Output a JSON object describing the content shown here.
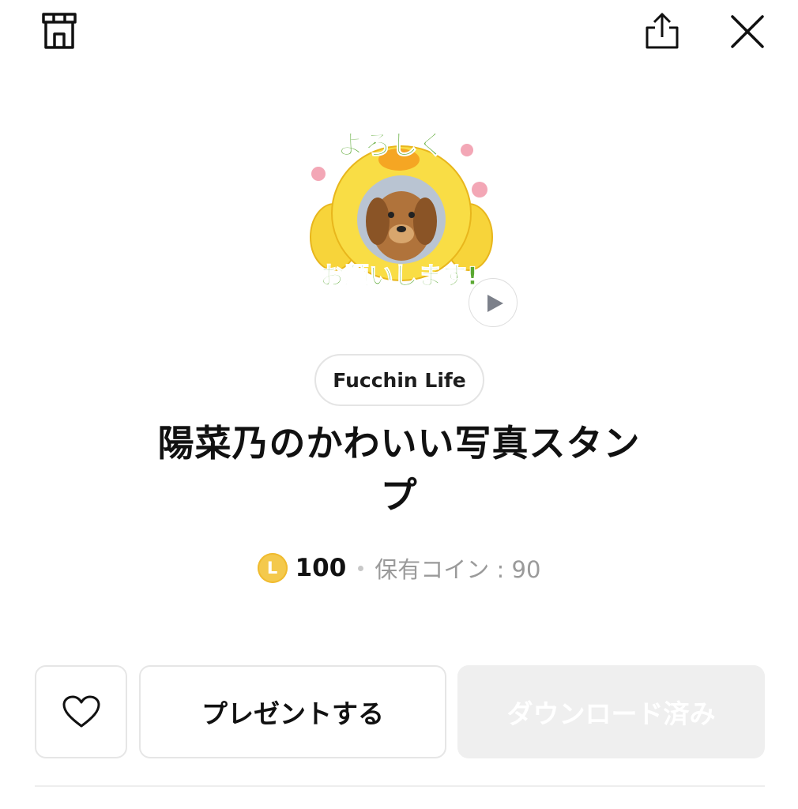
{
  "header": {
    "shop_icon": "shop-icon",
    "share_icon": "share-icon",
    "close_icon": "close-icon"
  },
  "sticker": {
    "text_top": "よろしく",
    "text_bottom": "お願いします!",
    "play_icon": "play-icon"
  },
  "author": "Fucchin Life",
  "title_line1": "陽菜乃のかわいい写真スタン",
  "title_line2": "プ",
  "pricing": {
    "coin_letter": "L",
    "price": "100",
    "owned_coins": "保有コイン : 90"
  },
  "actions": {
    "like_icon": "heart-icon",
    "gift_label": "プレゼントする",
    "download_label": "ダウンロード済み"
  },
  "colors": {
    "coin": "#f4c94c",
    "text": "#111111",
    "muted": "#9a9a9a",
    "border": "#e6e6e6",
    "disabled_bg": "#efefef"
  }
}
